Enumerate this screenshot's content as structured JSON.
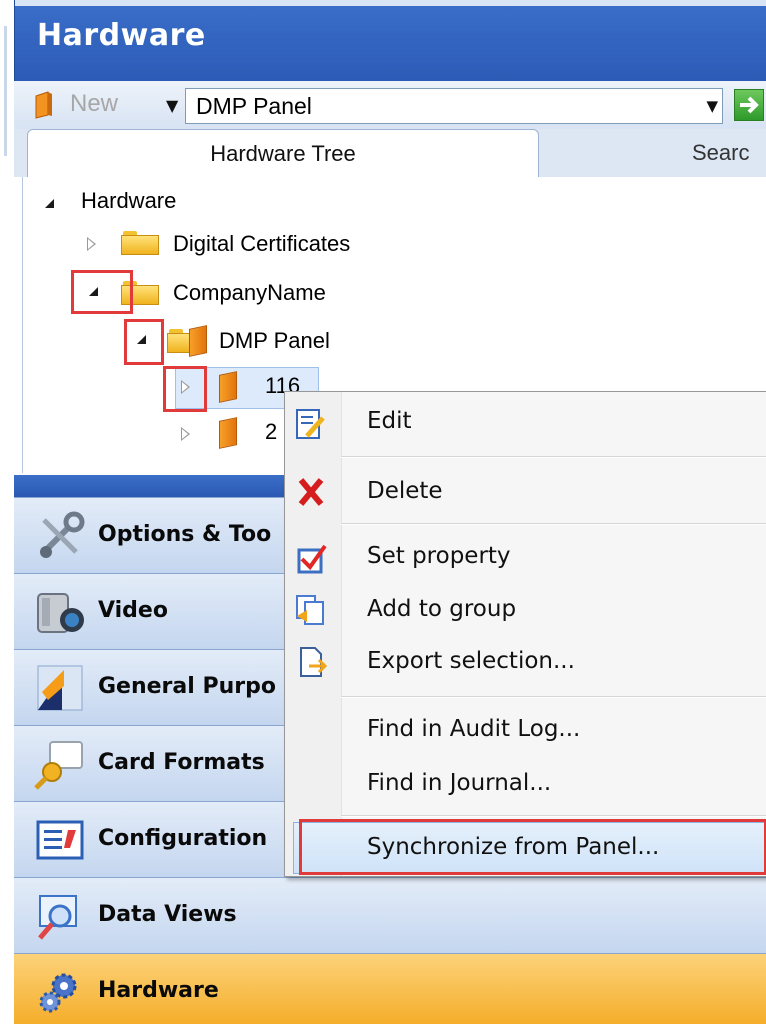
{
  "window": {
    "title": "Hardware"
  },
  "toolbar": {
    "new_label": "New",
    "panel_type": "DMP Panel"
  },
  "tabs": [
    {
      "label": "Hardware Tree"
    },
    {
      "label": "Searc"
    }
  ],
  "tree": {
    "root": "Hardware",
    "items": [
      {
        "label": "Digital Certificates"
      },
      {
        "label": "CompanyName"
      },
      {
        "label": "DMP Panel"
      },
      {
        "label": "116"
      },
      {
        "label": "2"
      }
    ]
  },
  "nav": [
    {
      "label": "Options & Too"
    },
    {
      "label": "Video"
    },
    {
      "label": "General Purpo"
    },
    {
      "label": "Card Formats"
    },
    {
      "label": "Configuration"
    },
    {
      "label": "Data Views"
    },
    {
      "label": "Hardware"
    }
  ],
  "context_menu": {
    "items": [
      {
        "label": "Edit",
        "icon": "edit-icon"
      },
      {
        "label": "Delete",
        "icon": "delete-x-icon"
      },
      {
        "label": "Set property",
        "icon": "checkbox-icon"
      },
      {
        "label": "Add to group",
        "icon": "add-group-icon"
      },
      {
        "label": "Export selection...",
        "icon": "export-icon"
      },
      {
        "label": "Find in Audit Log..."
      },
      {
        "label": "Find in Journal..."
      },
      {
        "label": "Synchronize from Panel..."
      }
    ]
  },
  "colors": {
    "accent": "#2c5bb6",
    "highlight": "#e03a3a",
    "active_nav": "#f7b52e"
  }
}
